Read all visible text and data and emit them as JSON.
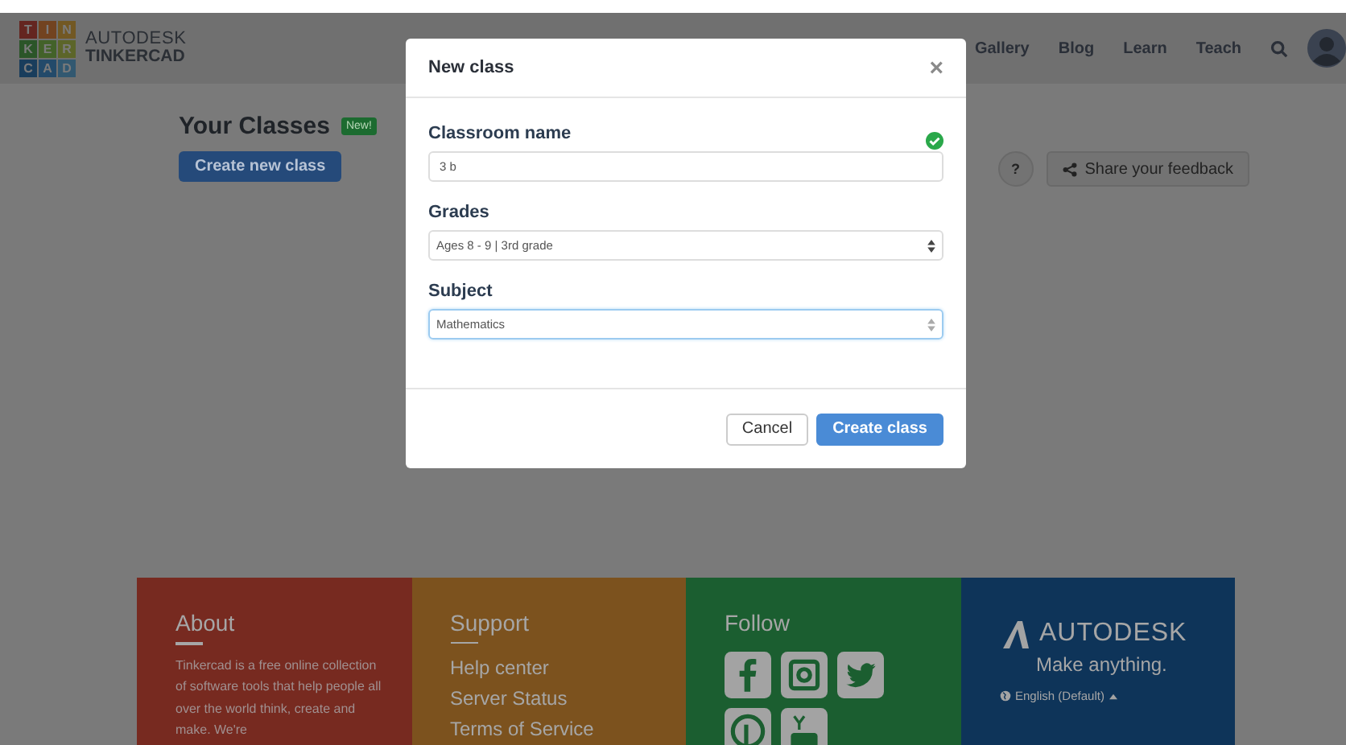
{
  "header": {
    "logo_letters": [
      "T",
      "I",
      "N",
      "K",
      "E",
      "R",
      "C",
      "A",
      "D"
    ],
    "brand_top": "AUTODESK",
    "brand_bottom": "TINKERCAD",
    "nav": [
      {
        "label": "Gallery"
      },
      {
        "label": "Blog"
      },
      {
        "label": "Learn"
      },
      {
        "label": "Teach"
      }
    ]
  },
  "page": {
    "title": "Your Classes",
    "badge": "New!",
    "create_button": "Create new class",
    "help_button": "?",
    "feedback_button": "Share your feedback"
  },
  "modal": {
    "title": "New class",
    "close": "×",
    "fields": [
      {
        "kind": "text",
        "label": "Classroom name",
        "value": "3 b",
        "valid": true,
        "focused": false
      },
      {
        "kind": "select",
        "label": "Grades",
        "value": "Ages 8 - 9 | 3rd grade",
        "valid": false,
        "focused": false
      },
      {
        "kind": "select",
        "label": "Subject",
        "value": "Mathematics",
        "valid": false,
        "focused": true
      }
    ],
    "buttons": [
      {
        "label": "Cancel",
        "kind": "secondary"
      },
      {
        "label": "Create class",
        "kind": "primary"
      }
    ]
  },
  "footer": {
    "about": {
      "title": "About",
      "text": "Tinkercad is a free online collection of software tools that help people all over the world think, create and make. We're"
    },
    "support": {
      "title": "Support",
      "links": [
        "Help center",
        "Server Status",
        "Terms of Service"
      ]
    },
    "follow": {
      "title": "Follow"
    },
    "autodesk": {
      "brand": "AUTODESK",
      "tagline": "Make anything.",
      "language": "English (Default)"
    }
  }
}
